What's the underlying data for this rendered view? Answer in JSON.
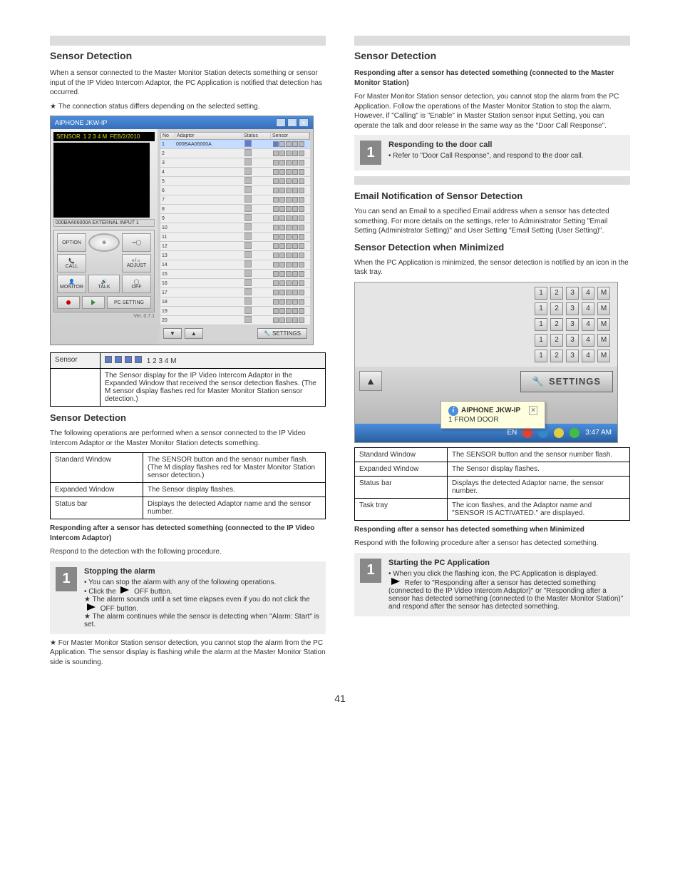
{
  "page_number": "41",
  "left": {
    "section_title": "Sensor Detection",
    "intro": "When a sensor connected to the Master Monitor Station detects something or sensor input of the IP Video Intercom Adaptor, the PC Application is notified that detection has occurred.",
    "intro_star": "The connection status differs depending on the selected setting.",
    "app_window": {
      "title": "AIPHONE JKW-IP",
      "sensor_label": "SENSOR",
      "sensor_nums": "1 2 3 4 M",
      "date": "FEB/2/2010",
      "info_strip": "000BAA06000A EXTERNAL INPUT 1",
      "buttons": {
        "option": "OPTION",
        "call": "CALL",
        "adjust": "ADJUST",
        "monitor": "MONITOR",
        "talk": "TALK",
        "off": "OFF",
        "pc_setting": "PC SETTING"
      },
      "version": "Ver. 0.7.1",
      "list_headers": [
        "No",
        "Adaptor",
        "Status",
        "Sensor"
      ],
      "list_first_adaptor": "000BAA06000A",
      "row_count": 20,
      "footer_settings": "SETTINGS"
    },
    "sensor_table": {
      "header_left": "Sensor",
      "header_right_items": [
        "1",
        "2",
        "3",
        "4",
        "M"
      ],
      "body": "The Sensor display for the IP Video Intercom Adaptor in the Expanded Window that received the sensor detection flashes. (The M sensor display flashes red for Master Monitor Station sensor detection.)"
    },
    "sensor_detection_title": "Sensor Detection",
    "sensor_detection_text": "The following operations are performed when a sensor connected to the IP Video Intercom Adaptor or the Master Monitor Station detects something.",
    "op_table": [
      [
        "Standard Window",
        "The SENSOR button and the sensor number flash. (The M display flashes red for Master Monitor Station sensor detection.)"
      ],
      [
        "Expanded Window",
        "The Sensor display flashes."
      ],
      [
        "Status bar",
        "Displays the detected Adaptor name and the sensor number."
      ]
    ],
    "response_hdr": "Responding after a sensor has detected something (connected to the IP Video Intercom Adaptor)",
    "response_text": "Respond to the detection with the following procedure.",
    "step_num": "1",
    "step_hdr": "Stopping the alarm",
    "step_bullets": [
      "You can stop the alarm with any of the following operations.",
      "Click the      OFF button.",
      "The alarm sounds until a set time elapses even if you do not click the      OFF button.",
      "The alarm continues while the sensor is detecting when \"Alarm: Start\" is set."
    ],
    "note": "For Master Monitor Station sensor detection, you cannot stop the alarm from the PC Application. The sensor display is flashing while the alarm at the Master Monitor Station side is sounding."
  },
  "right": {
    "section_title": "Sensor Detection",
    "hdr1": "Responding after a sensor has detected something (connected to the Master Monitor Station)",
    "text1": "For Master Monitor Station sensor detection, you cannot stop the alarm from the PC Application. Follow the operations of the Master Monitor Station to stop the alarm. However, if \"Calling\" is \"Enable\" in Master Station sensor input Setting, you can operate the talk and door release in the same way as the \"Door Call Response\".",
    "step_num1": "1",
    "step1_hdr": "Responding to the door call",
    "step1_text": "Refer to \"Door Call Response\", and respond to the door call.",
    "sub_title": "Email Notification of Sensor Detection",
    "sub_text": "You can send an Email to a specified Email address when a sensor has detected something. For more details on the settings, refer to Administrator Setting \"Email Setting (Administrator Setting)\" and User Setting \"Email Setting (User Setting)\".",
    "minimized_hdr": "Sensor Detection when Minimized",
    "minimized_text": "When the PC Application is minimized, the sensor detection is notified by an icon in the task tray.",
    "balloon_title": "AIPHONE JKW-IP",
    "balloon_msg": "1 FROM DOOR",
    "taskbar_lang": "EN",
    "taskbar_time": "3:47 AM",
    "settings_label": "SETTINGS",
    "min_table": [
      [
        "Standard Window",
        "The SENSOR button and the sensor number flash."
      ],
      [
        "Expanded Window",
        "The Sensor display flashes."
      ],
      [
        "Status bar",
        "Displays the detected Adaptor name, the sensor number."
      ],
      [
        "Task tray",
        "The icon flashes, and the Adaptor name and \"SENSOR IS ACTIVATED.\" are displayed."
      ]
    ],
    "response2_hdr": "Responding after a sensor has detected something when Minimized",
    "response2_text": "Respond with the following procedure after a sensor has detected something.",
    "step_num2": "1",
    "step2_hdr": "Starting the PC Application",
    "step2_text": "When you click the flashing icon, the PC Application is displayed.",
    "step2_sub": "Refer to \"Responding after a sensor has detected something (connected to the IP Video Intercom Adaptor)\" or \"Responding after a sensor has detected something (connected to the Master Monitor Station)\" and respond after the sensor has detected something."
  }
}
